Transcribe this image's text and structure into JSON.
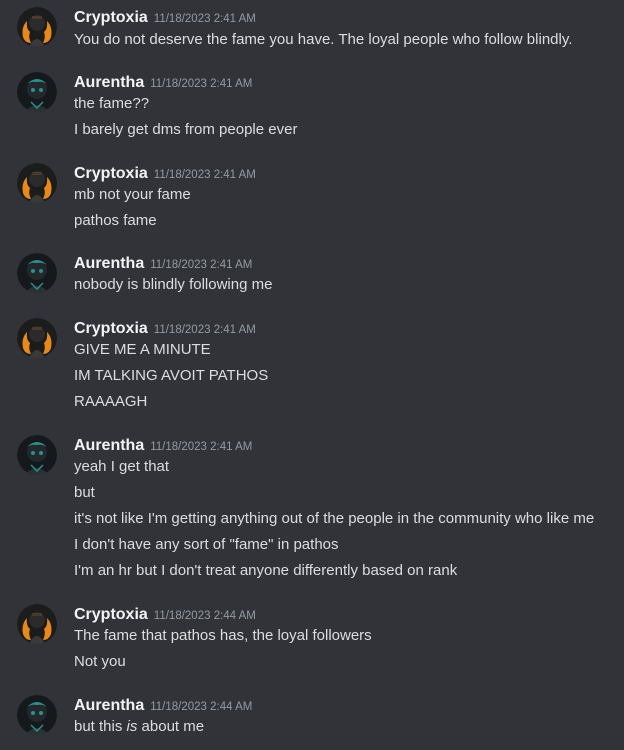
{
  "messages": [
    {
      "author": "Cryptoxia",
      "avatar_icon": "crypto-avatar-icon",
      "timestamp": "11/18/2023 2:41 AM",
      "lines": [
        "You do not deserve the fame you have. The loyal people who follow blindly."
      ]
    },
    {
      "author": "Aurentha",
      "avatar_icon": "aurentha-avatar-icon",
      "timestamp": "11/18/2023 2:41 AM",
      "lines": [
        "the fame??",
        "I barely get dms from people ever"
      ]
    },
    {
      "author": "Cryptoxia",
      "avatar_icon": "crypto-avatar-icon",
      "timestamp": "11/18/2023 2:41 AM",
      "lines": [
        "mb not your fame",
        "pathos fame"
      ]
    },
    {
      "author": "Aurentha",
      "avatar_icon": "aurentha-avatar-icon",
      "timestamp": "11/18/2023 2:41 AM",
      "lines": [
        "nobody is blindly following me"
      ]
    },
    {
      "author": "Cryptoxia",
      "avatar_icon": "crypto-avatar-icon",
      "timestamp": "11/18/2023 2:41 AM",
      "lines": [
        "GIVE ME A MINUTE",
        "IM TALKING AVOIT PATHOS",
        "RAAAAGH"
      ]
    },
    {
      "author": "Aurentha",
      "avatar_icon": "aurentha-avatar-icon",
      "timestamp": "11/18/2023 2:41 AM",
      "lines": [
        "yeah I get that",
        "but",
        "it's not like I'm getting anything out of the people in the community who like me",
        "I don't have any sort of \"fame\" in pathos",
        "I'm an hr but I don't treat anyone differently based on rank"
      ]
    },
    {
      "author": "Cryptoxia",
      "avatar_icon": "crypto-avatar-icon",
      "timestamp": "11/18/2023 2:44 AM",
      "lines": [
        "The fame that pathos has, the loyal followers",
        "Not you"
      ]
    },
    {
      "author": "Aurentha",
      "avatar_icon": "aurentha-avatar-icon",
      "timestamp": "11/18/2023 2:44 AM",
      "lines": [
        "but this is about me"
      ],
      "emphasis": {
        "before": "but this ",
        "italic": "is",
        "after": " about me"
      }
    }
  ],
  "colors": {
    "background": "#313338",
    "username": "#f2f3f5",
    "timestamp": "#949ba4",
    "text": "#dbdee1",
    "crypto_flame": "#e8891a",
    "aurentha_teal": "#2e8f8c"
  }
}
